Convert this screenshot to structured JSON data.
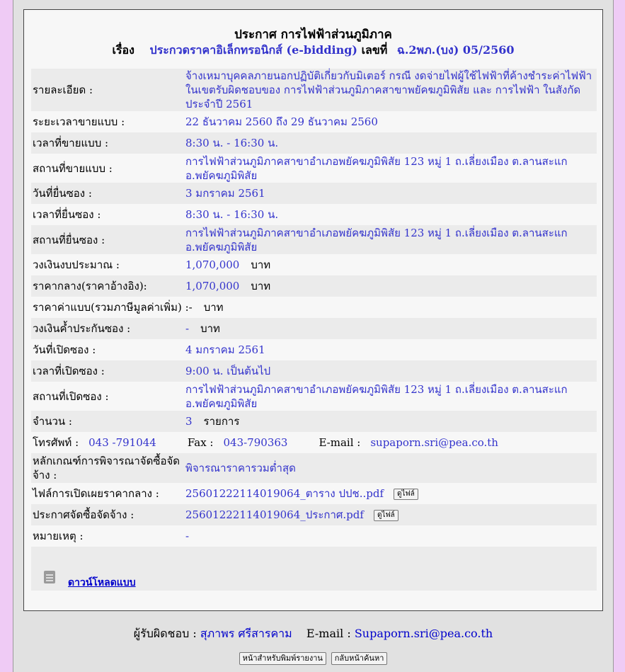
{
  "header": {
    "title": "ประกาศ การไฟฟ้าส่วนภูมิภาค",
    "subject_label": "เรื่อง",
    "subject_value": "ประกวดราคาอิเล็กทรอนิกส์ (e-bidding)",
    "number_label": "เลขที่",
    "number_value": "ฉ.2พภ.(บง) 05/2560"
  },
  "details": {
    "detail_label": "รายละเอียด :",
    "detail_value": "จ้างเหมาบุคคลภายนอกปฏิบัติเกี่ยวกับมิเตอร์ กรณี งดจ่ายไฟผู้ใช้ไฟฟ้าที่ค้างชำระค่าไฟฟ้าในเขตรับผิดชอบของ การไฟฟ้าส่วนภูมิภาคสาขาพยัคฆภูมิพิสัย และ การไฟฟ้า ในสังกัด ประจำปี 2561",
    "sale_period_label": "ระยะเวลาขายแบบ :",
    "sale_period_value": "22 ธันวาคม 2560 ถึง 29 ธันวาคม 2560",
    "sale_time_label": "เวลาที่ขายแบบ :",
    "sale_time_value": "8:30 น. - 16:30 น.",
    "sale_place_label": "สถานที่ขายแบบ :",
    "sale_place_value": "การไฟฟ้าส่วนภูมิภาคสาขาอำเภอพยัคฆภูมิพิสัย 123 หมู่ 1 ถ.เลี่ยงเมือง ต.ลานสะแก อ.พยัคฆภูมิพิสัย",
    "submit_date_label": "วันที่ยื่นซอง :",
    "submit_date_value": "3 มกราคม 2561",
    "submit_time_label": "เวลาที่ยื่นซอง :",
    "submit_time_value": "8:30 น. - 16:30 น.",
    "submit_place_label": "สถานที่ยื่นซอง :",
    "submit_place_value": "การไฟฟ้าส่วนภูมิภาคสาขาอำเภอพยัคฆภูมิพิสัย 123 หมู่ 1 ถ.เลี่ยงเมือง ต.ลานสะแก อ.พยัคฆภูมิพิสัย",
    "budget_label": "วงเงินงบประมาณ :",
    "budget_value": "1,070,000",
    "baht": "บาท",
    "median_label": "ราคากลาง(ราคาอ้างอิง):",
    "median_value": "1,070,000",
    "doc_price_label": "ราคาค่าแบบ(รวมภาษีมูลค่าเพิ่ม) :",
    "doc_price_value": "-",
    "guarantee_label": "วงเงินค้ำประกันซอง :",
    "guarantee_value": "-",
    "open_date_label": "วันที่เปิดซอง :",
    "open_date_value": "4 มกราคม 2561",
    "open_time_label": "เวลาที่เปิดซอง :",
    "open_time_value": "9:00 น. เป็นต้นไป",
    "open_place_label": "สถานที่เปิดซอง :",
    "open_place_value": "การไฟฟ้าส่วนภูมิภาคสาขาอำเภอพยัคฆภูมิพิสัย 123 หมู่ 1 ถ.เลี่ยงเมือง ต.ลานสะแก อ.พยัคฆภูมิพิสัย",
    "quantity_label": "จำนวน :",
    "quantity_value": "3",
    "quantity_unit": "รายการ",
    "phone_label": "โทรศัพท์ :",
    "phone_value": "043 -791044",
    "fax_label": "Fax :",
    "fax_value": "043-790363",
    "email_label": "E-mail :",
    "email_value": "supaporn.sri@pea.co.th",
    "criteria_label": "หลักเกณฑ์การพิจารณาจัดซื้อจัดจ้าง :",
    "criteria_value": "พิจารณาราคารวมต่ำสุด",
    "median_file_label": "ไฟล์การเปิดเผยราคากลาง :",
    "median_file_value": "25601222114019064_ตาราง ปปช..pdf",
    "announce_file_label": "ประกาศจัดซื้อจัดจ้าง :",
    "announce_file_value": "25601222114019064_ประกาศ.pdf",
    "view_file_button": "ดูไฟล์",
    "note_label": "หมายเหตุ :",
    "note_value": "-"
  },
  "download": {
    "icon": "document-icon",
    "label": "ดาวน์โหลดแบบ"
  },
  "footer": {
    "responsible_label": "ผู้รับผิดชอบ :",
    "responsible_value": "สุภาพร ศรีสารคาม",
    "email_label": "E-mail :",
    "email_value": "Supaporn.sri@pea.co.th",
    "print_button": "หน้าสำหรับพิมพ์รายงาน",
    "back_button": "กลับหน้าค้นหา"
  },
  "colors": {
    "background": "#efcbf5",
    "value_text": "#3333cc",
    "link": "#0000cc"
  }
}
